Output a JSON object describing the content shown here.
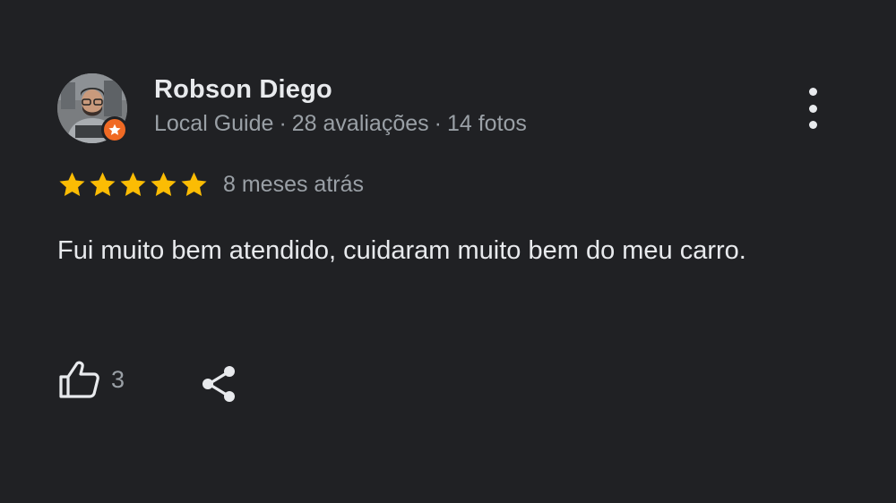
{
  "reviewer": {
    "name": "Robson Diego",
    "badge": "Local Guide",
    "reviews_count": "28 avaliações",
    "photos_count": "14 fotos",
    "separator": "·",
    "avatar_icon": "user-photo",
    "badge_icon": "star-badge-icon",
    "badge_color": "#f06a24"
  },
  "rating": {
    "stars": 5,
    "max": 5,
    "star_color": "#fbbc04",
    "time_ago": "8 meses atrás"
  },
  "review": {
    "text": "Fui muito bem atendido, cuidaram muito bem do meu carro."
  },
  "actions": {
    "like_icon": "thumbs-up-icon",
    "like_count": "3",
    "share_icon": "share-icon",
    "more_icon": "more-vert-icon"
  },
  "colors": {
    "background": "#202124",
    "primary_text": "#e8eaed",
    "secondary_text": "#9aa0a6"
  }
}
